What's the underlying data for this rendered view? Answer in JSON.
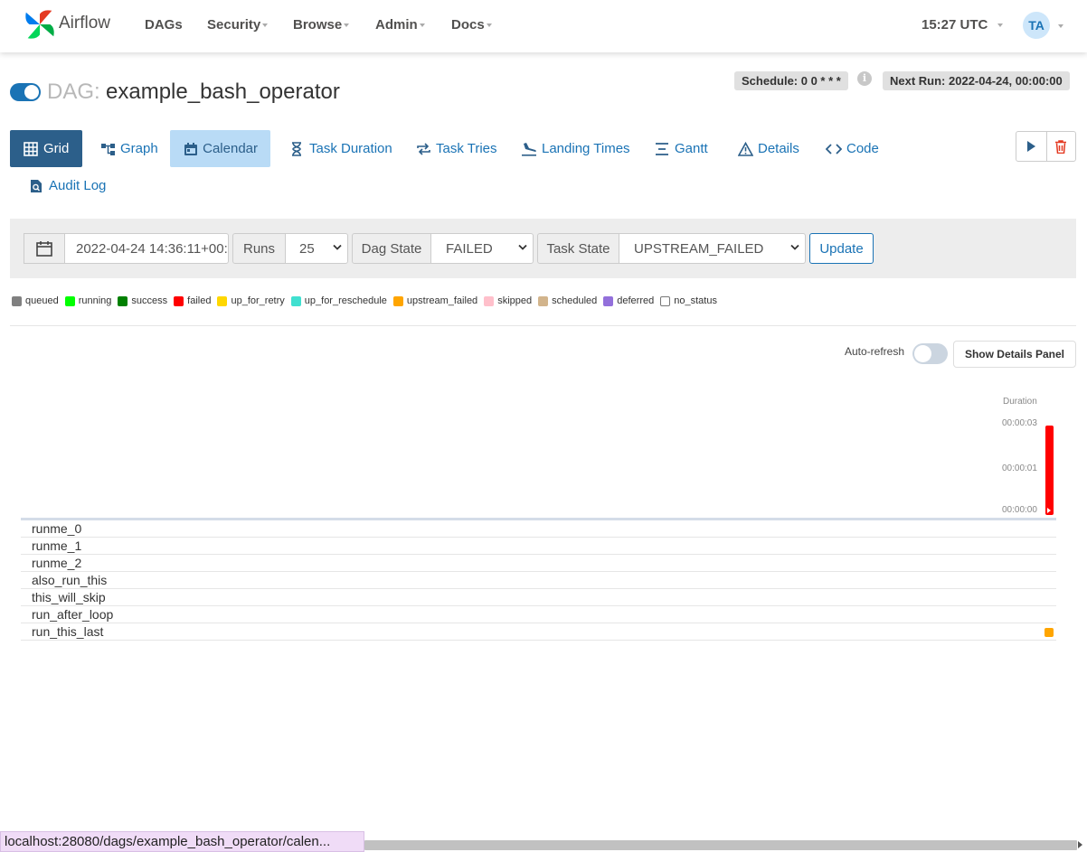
{
  "nav": {
    "brand": "Airflow",
    "items": [
      "DAGs",
      "Security",
      "Browse",
      "Admin",
      "Docs"
    ],
    "clock": "15:27 UTC",
    "avatar": "TA"
  },
  "dag": {
    "prefix": "DAG:",
    "name": "example_bash_operator",
    "paused": false,
    "schedule": "Schedule: 0 0 * * *",
    "next_run": "Next Run: 2022-04-24, 00:00:00"
  },
  "tabs": [
    {
      "label": "Grid",
      "icon": "grid-icon",
      "state": "selected"
    },
    {
      "label": "Graph",
      "icon": "graph-icon",
      "state": "normal"
    },
    {
      "label": "Calendar",
      "icon": "calendar-icon",
      "state": "hover"
    },
    {
      "label": "Task Duration",
      "icon": "hourglass-icon",
      "state": "normal"
    },
    {
      "label": "Task Tries",
      "icon": "retry-icon",
      "state": "normal"
    },
    {
      "label": "Landing Times",
      "icon": "plane-landing-icon",
      "state": "normal"
    },
    {
      "label": "Gantt",
      "icon": "gantt-icon",
      "state": "normal"
    },
    {
      "label": "Details",
      "icon": "warning-triangle-icon",
      "state": "normal"
    },
    {
      "label": "Code",
      "icon": "code-icon",
      "state": "normal"
    },
    {
      "label": "Audit Log",
      "icon": "file-search-icon",
      "state": "normal"
    }
  ],
  "actions": [
    "play-icon",
    "trash-icon"
  ],
  "filters": {
    "base_date": "2022-04-24 14:36:11+00:",
    "runs_label": "Runs",
    "runs_value": "25",
    "dag_state_label": "Dag State",
    "dag_state_value": "FAILED",
    "task_state_label": "Task State",
    "task_state_value": "UPSTREAM_FAILED",
    "update": "Update"
  },
  "legend": [
    {
      "label": "queued",
      "color": "#808080"
    },
    {
      "label": "running",
      "color": "#00ff00"
    },
    {
      "label": "success",
      "color": "#008000"
    },
    {
      "label": "failed",
      "color": "#ff0000"
    },
    {
      "label": "up_for_retry",
      "color": "#ffd700"
    },
    {
      "label": "up_for_reschedule",
      "color": "#40e0d0"
    },
    {
      "label": "upstream_failed",
      "color": "#ffa500"
    },
    {
      "label": "skipped",
      "color": "#ffc0cb"
    },
    {
      "label": "scheduled",
      "color": "#d2b48c"
    },
    {
      "label": "deferred",
      "color": "#9370db"
    },
    {
      "label": "no_status",
      "color": "#ffffff"
    }
  ],
  "grid": {
    "autorefresh_label": "Auto-refresh",
    "autorefresh_on": false,
    "details_button": "Show Details Panel",
    "duration_title": "Duration",
    "duration_ticks": [
      "00:00:03",
      "00:00:01",
      "00:00:00"
    ],
    "run_state_color": "#ff0000",
    "tasks": [
      {
        "name": "runme_0",
        "state_color": null
      },
      {
        "name": "runme_1",
        "state_color": null
      },
      {
        "name": "runme_2",
        "state_color": null
      },
      {
        "name": "also_run_this",
        "state_color": null
      },
      {
        "name": "this_will_skip",
        "state_color": null
      },
      {
        "name": "run_after_loop",
        "state_color": null
      },
      {
        "name": "run_this_last",
        "state_color": "#ffa500"
      }
    ]
  },
  "status_url": "localhost:28080/dags/example_bash_operator/calen..."
}
